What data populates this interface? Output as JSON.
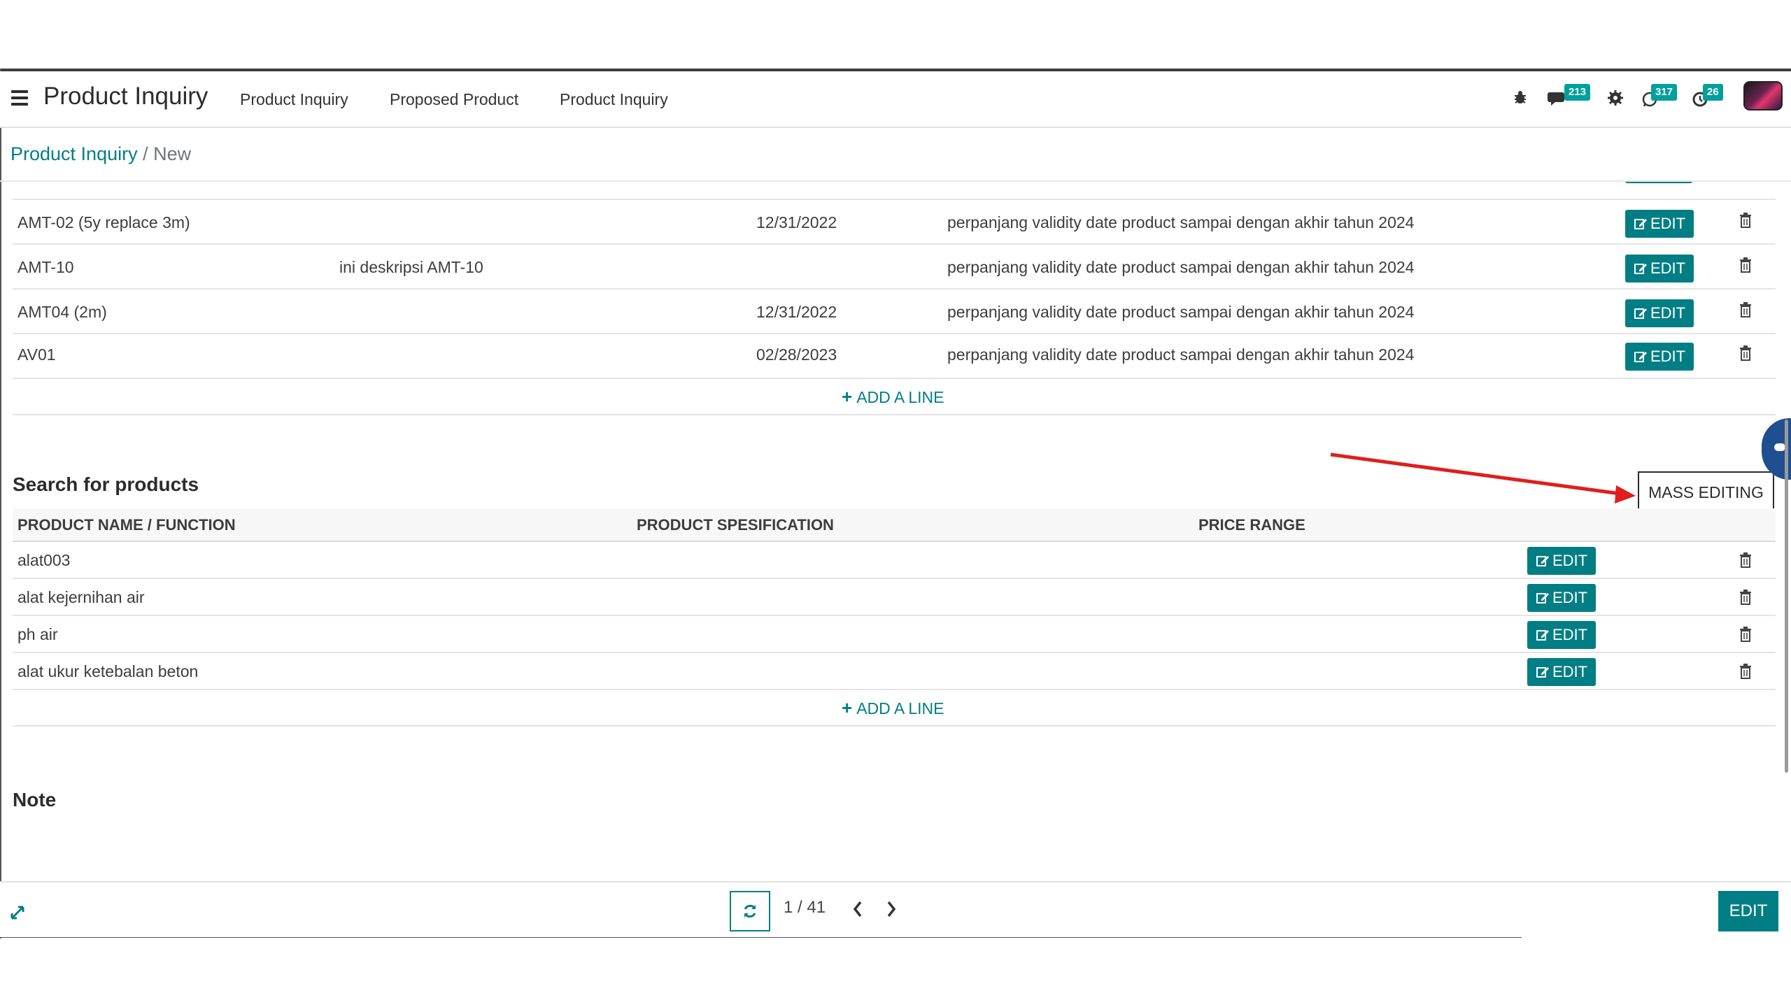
{
  "navbar": {
    "app_title": "Product Inquiry",
    "menus": [
      "Product Inquiry",
      "Proposed Product",
      "Product Inquiry"
    ],
    "chat_count": "213",
    "activity_count": "317",
    "clock_count": "26"
  },
  "breadcrumb": {
    "parent": "Product Inquiry",
    "separator": " / ",
    "current": "New"
  },
  "inquiry_lines": {
    "rows": [
      {
        "product": "AMT-02 (5y replace 3m)",
        "description": "",
        "date": "12/31/2022",
        "note": "perpanjang validity date product sampai dengan akhir tahun 2024"
      },
      {
        "product": "AMT-10",
        "description": "ini deskripsi AMT-10",
        "date": "",
        "note": "perpanjang validity date product sampai dengan akhir tahun 2024"
      },
      {
        "product": "AMT04 (2m)",
        "description": "",
        "date": "12/31/2022",
        "note": "perpanjang validity date product sampai dengan akhir tahun 2024"
      },
      {
        "product": "AV01",
        "description": "",
        "date": "02/28/2023",
        "note": "perpanjang validity date product sampai dengan akhir tahun 2024"
      }
    ],
    "edit_label": "EDIT",
    "add_line": "ADD A LINE"
  },
  "search_section": {
    "title": "Search for products",
    "mass_editing": "MASS EDITING",
    "columns": [
      "PRODUCT NAME / FUNCTION",
      "PRODUCT SPESIFICATION",
      "PRICE RANGE"
    ],
    "rows": [
      "alat003",
      "alat kejernihan air",
      "ph air",
      "alat ukur ketebalan beton"
    ],
    "edit_label": "EDIT",
    "add_line": "ADD A LINE"
  },
  "note_section": {
    "title": "Note"
  },
  "footer": {
    "pager": "1 / 41",
    "edit": "EDIT"
  },
  "colors": {
    "accent": "#017e84",
    "badge": "#00a09d",
    "arrow": "#e01e1e"
  }
}
